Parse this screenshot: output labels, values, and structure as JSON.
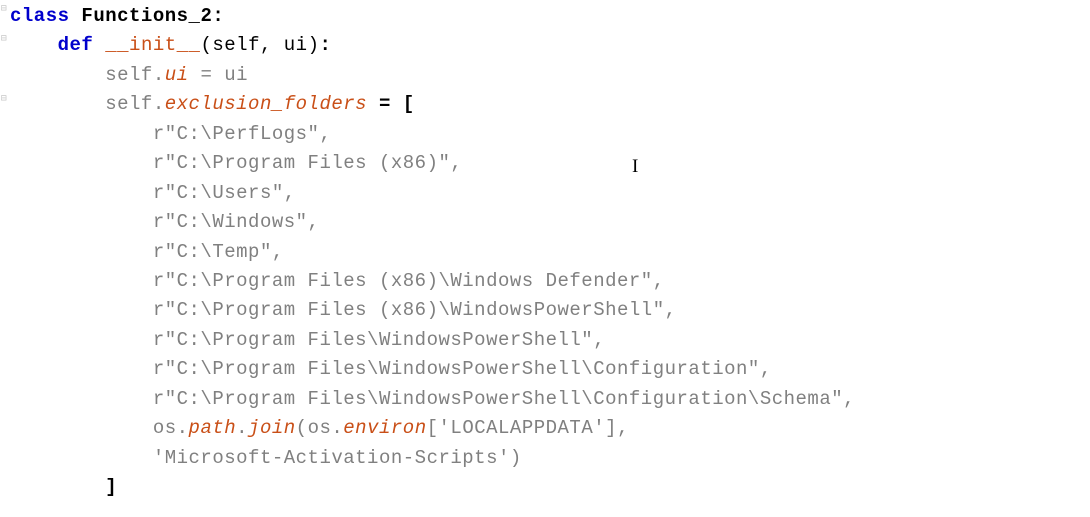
{
  "class_decl": {
    "kw": "class",
    "name": "Functions_2"
  },
  "method_decl": {
    "kw": "def",
    "dunder_pre": "__",
    "name": "init",
    "dunder_post": "__",
    "args": "(self, ui)"
  },
  "body": {
    "assign_ui": {
      "lhs": "self.",
      "attr": "ui",
      "rhs": " = ui"
    },
    "assign_excl": {
      "lhs": "self.",
      "attr": "exclusion_folders",
      "eq": " = "
    },
    "strings": [
      "r\"C:\\PerfLogs\",",
      "r\"C:\\Program Files (x86)\",",
      "r\"C:\\Users\",",
      "r\"C:\\Windows\",",
      "r\"C:\\Temp\",",
      "r\"C:\\Program Files (x86)\\Windows Defender\",",
      "r\"C:\\Program Files (x86)\\WindowsPowerShell\",",
      "r\"C:\\Program Files\\WindowsPowerShell\",",
      "r\"C:\\Program Files\\WindowsPowerShell\\Configuration\",",
      "r\"C:\\Program Files\\WindowsPowerShell\\Configuration\\Schema\","
    ],
    "osjoin": {
      "pre": "os.",
      "path": "path",
      "dot2": ".",
      "join": "join",
      "open": "(os.",
      "environ": "environ",
      "bracket_open": "[",
      "envkey": "'LOCALAPPDATA'",
      "bracket_close": "]",
      "comma": ","
    },
    "continuation": "'Microsoft-Activation-Scripts')"
  },
  "brackets": {
    "open": "[",
    "close": "]"
  },
  "caret_glyph": "I"
}
